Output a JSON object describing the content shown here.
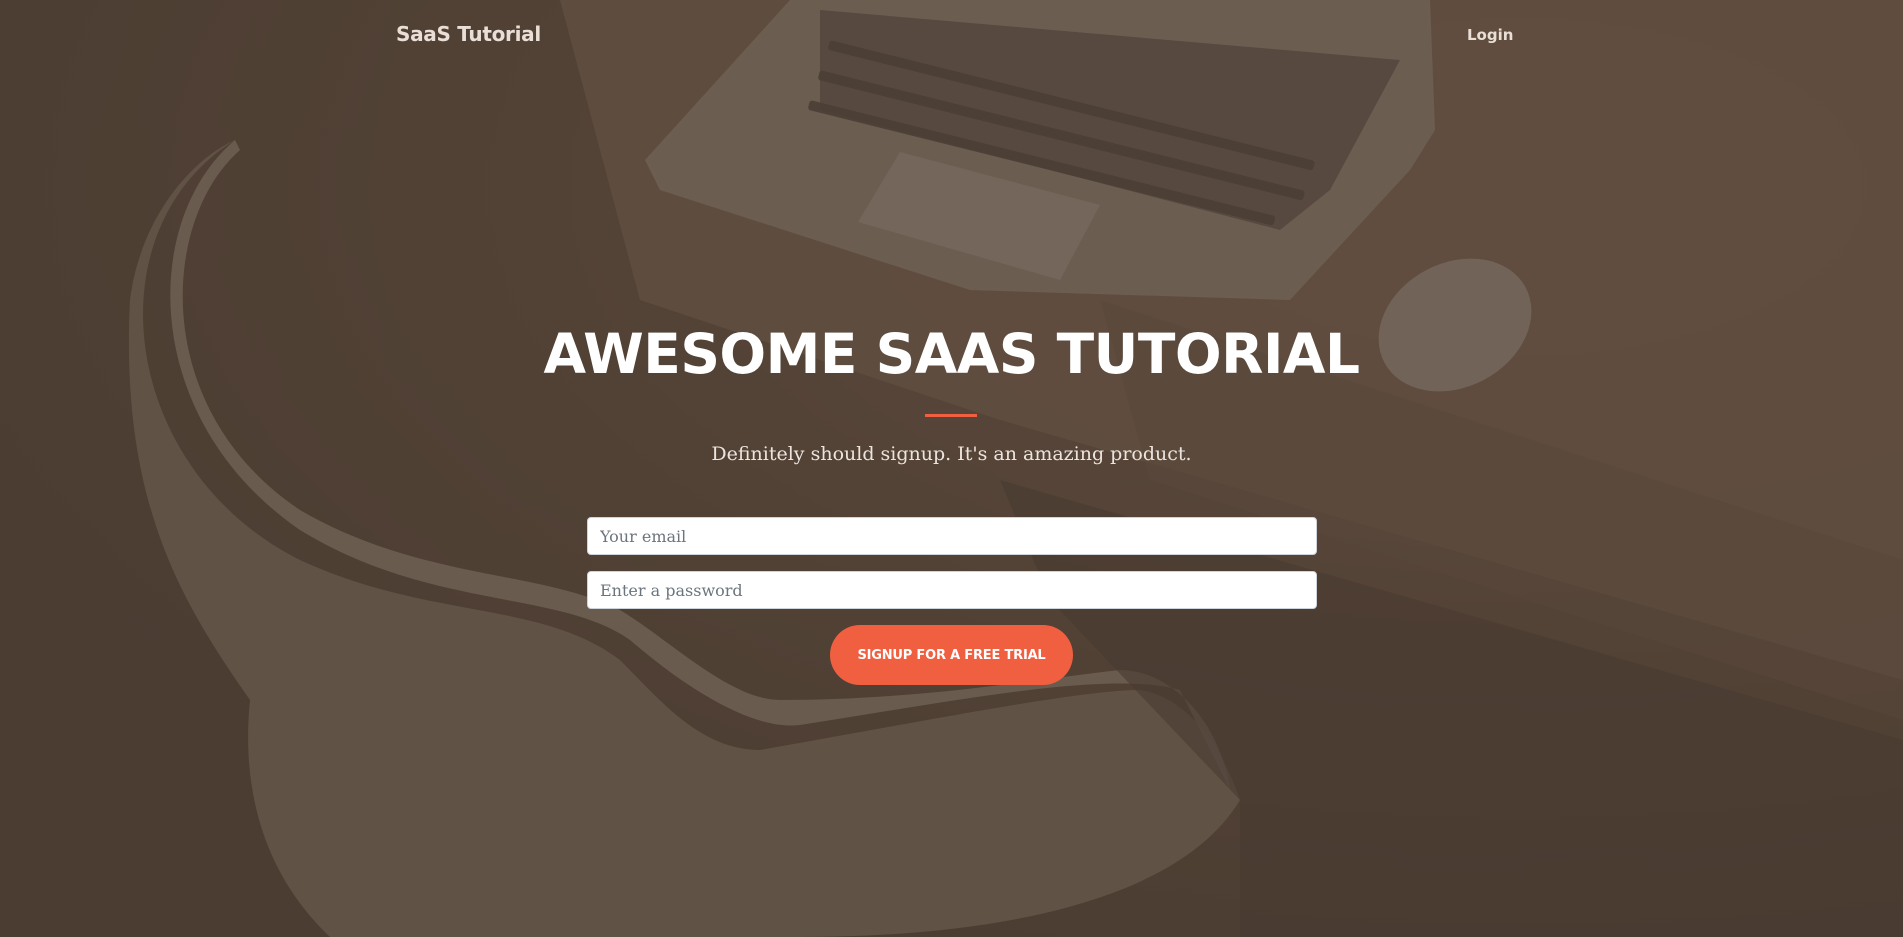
{
  "navbar": {
    "brand": "SaaS Tutorial",
    "login_label": "Login"
  },
  "hero": {
    "title": "AWESOME SAAS TUTORIAL",
    "subtitle": "Definitely should signup. It's an amazing product.",
    "email_placeholder": "Your email",
    "password_placeholder": "Enter a password",
    "signup_label": "SIGNUP FOR A FREE TRIAL"
  },
  "colors": {
    "accent": "#f05f40",
    "overlay": "#4e3f34",
    "text_light": "#ffffff"
  },
  "background": {
    "icon": "desk-photo-with-laptop-mouse-and-chair"
  }
}
